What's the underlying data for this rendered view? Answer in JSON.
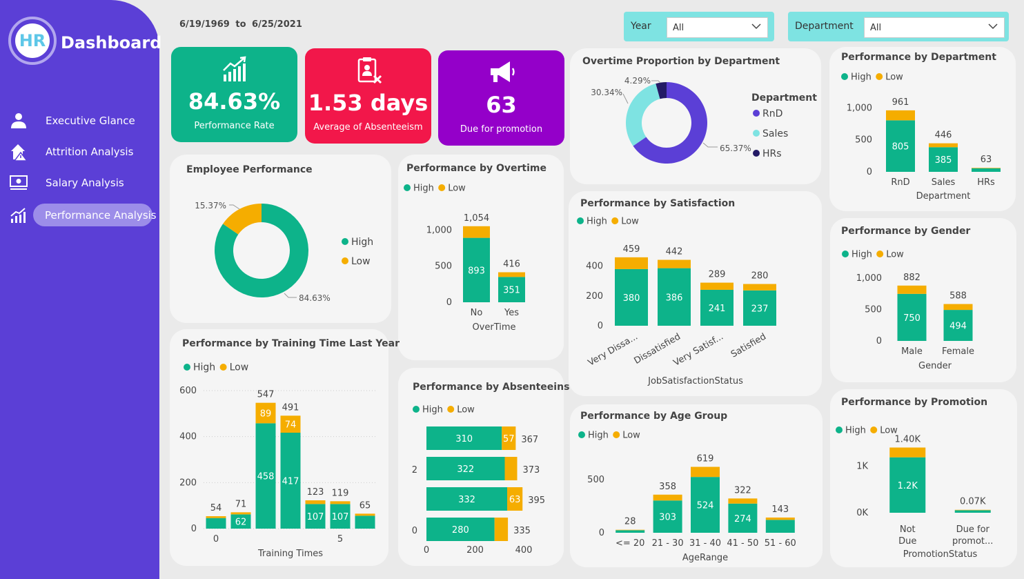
{
  "sidebar": {
    "logo_text": "HR",
    "brand": "Dashboard",
    "items": [
      {
        "label": "Executive Glance",
        "icon": "person-icon",
        "active": false
      },
      {
        "label": "Attrition Analysis",
        "icon": "house-warning-icon",
        "active": false
      },
      {
        "label": "Salary Analysis",
        "icon": "money-icon",
        "active": false
      },
      {
        "label": "Performance Analysis",
        "icon": "chart-up-icon",
        "active": true
      }
    ]
  },
  "header": {
    "date_from": "6/19/1969",
    "date_sep": "to",
    "date_to": "6/25/2021",
    "year_slicer": {
      "label": "Year",
      "value": "All"
    },
    "department_slicer": {
      "label": "Department",
      "value": "All"
    }
  },
  "kpis": [
    {
      "value": "84.63%",
      "label": "Performance Rate",
      "color": "#0db38a",
      "icon": "trend-up-icon"
    },
    {
      "value": "1.53 days",
      "label": "Average of Absenteeism",
      "color": "#f2174a",
      "icon": "clipboard-x-icon"
    },
    {
      "value": "63",
      "label": "Due for promotion",
      "color": "#9400c9",
      "icon": "megaphone-icon"
    }
  ],
  "colors": {
    "high": "#0db38a",
    "low": "#f5ad00",
    "rnd": "#5b3fd6",
    "sales": "#7ee3e2",
    "hrs": "#241b66"
  },
  "legend": {
    "high": "High",
    "low": "Low"
  },
  "chart_data": [
    {
      "id": "employee-performance",
      "type": "pie",
      "title": "Employee Performance",
      "slices": [
        {
          "name": "High",
          "value": 84.63,
          "label": "84.63%"
        },
        {
          "name": "Low",
          "value": 15.37,
          "label": "15.37%"
        }
      ]
    },
    {
      "id": "performance-by-overtime",
      "type": "bar",
      "title": "Performance by Overtime",
      "xlabel": "OverTime",
      "categories": [
        "No",
        "Yes"
      ],
      "series": [
        {
          "name": "High",
          "values": [
            893,
            351
          ]
        },
        {
          "name": "Low",
          "values": [
            161,
            65
          ]
        }
      ],
      "totals": [
        1054,
        416
      ],
      "ylim": [
        0,
        1100
      ],
      "yticks": [
        "0",
        "500",
        "1,000"
      ]
    },
    {
      "id": "overtime-proportion",
      "type": "pie",
      "title": "Overtime Proportion by Department",
      "legend_title": "Department",
      "slices": [
        {
          "name": "RnD",
          "value": 65.37,
          "label": "65.37%"
        },
        {
          "name": "Sales",
          "value": 30.34,
          "label": "30.34%"
        },
        {
          "name": "HRs",
          "value": 4.29,
          "label": "4.29%"
        }
      ]
    },
    {
      "id": "performance-by-department",
      "type": "bar",
      "title": "Performance by Department",
      "xlabel": "Department",
      "categories": [
        "RnD",
        "Sales",
        "HRs"
      ],
      "series": [
        {
          "name": "High",
          "values": [
            805,
            385,
            56
          ]
        },
        {
          "name": "Low",
          "values": [
            156,
            61,
            7
          ]
        }
      ],
      "totals": [
        961,
        446,
        63
      ],
      "ylim": [
        0,
        1100
      ],
      "yticks": [
        "0",
        "500",
        "1,000"
      ]
    },
    {
      "id": "performance-by-satisfaction",
      "type": "bar",
      "title": "Performance by Satisfaction",
      "xlabel": "JobSatisfactionStatus",
      "categories": [
        "Very Dissa...",
        "Dissatisfied",
        "Very Satisf...",
        "Satisfied"
      ],
      "series": [
        {
          "name": "High",
          "values": [
            380,
            386,
            241,
            237
          ]
        },
        {
          "name": "Low",
          "values": [
            79,
            56,
            48,
            43
          ]
        }
      ],
      "totals": [
        459,
        442,
        289,
        280
      ],
      "ylim": [
        0,
        500
      ],
      "yticks": [
        "0",
        "200",
        "400"
      ]
    },
    {
      "id": "performance-by-gender",
      "type": "bar",
      "title": "Performance by Gender",
      "xlabel": "Gender",
      "categories": [
        "Male",
        "Female"
      ],
      "series": [
        {
          "name": "High",
          "values": [
            750,
            494
          ]
        },
        {
          "name": "Low",
          "values": [
            132,
            94
          ]
        }
      ],
      "totals": [
        882,
        588
      ],
      "ylim": [
        0,
        1100
      ],
      "yticks": [
        "0",
        "500",
        "1,000"
      ]
    },
    {
      "id": "performance-by-training",
      "type": "bar",
      "title": "Performance by Training Time Last Year",
      "xlabel": "Training Times",
      "categories": [
        "0",
        "1",
        "2",
        "3",
        "4",
        "5",
        "6"
      ],
      "xtick_labels": [
        "0",
        "",
        "",
        "",
        "",
        "5",
        ""
      ],
      "series": [
        {
          "name": "High",
          "values": [
            46,
            62,
            458,
            417,
            107,
            107,
            56
          ]
        },
        {
          "name": "Low",
          "values": [
            8,
            9,
            89,
            74,
            16,
            12,
            9
          ]
        }
      ],
      "totals": [
        54,
        71,
        547,
        491,
        123,
        119,
        65
      ],
      "ylim": [
        0,
        600
      ],
      "yticks": [
        "0",
        "200",
        "400",
        "600"
      ]
    },
    {
      "id": "performance-by-absenteeism",
      "type": "bar",
      "orientation": "horizontal",
      "title": "Performance by Absenteeins",
      "categories": [
        "0",
        "1",
        "2",
        "3"
      ],
      "ytick_labels": [
        "",
        "2",
        "",
        "0"
      ],
      "series": [
        {
          "name": "High",
          "values": [
            310,
            322,
            332,
            280
          ]
        },
        {
          "name": "Low",
          "values": [
            57,
            51,
            63,
            55
          ]
        }
      ],
      "totals": [
        367,
        373,
        395,
        335
      ],
      "xlim": [
        0,
        400
      ],
      "xticks": [
        "0",
        "200",
        "400"
      ]
    },
    {
      "id": "performance-by-age",
      "type": "bar",
      "title": "Performance by Age Group",
      "xlabel": "AgeRange",
      "categories": [
        "<= 20",
        "21 - 30",
        "31 - 40",
        "41 - 50",
        "51 - 60"
      ],
      "series": [
        {
          "name": "High",
          "values": [
            24,
            303,
            524,
            274,
            121
          ]
        },
        {
          "name": "Low",
          "values": [
            4,
            55,
            95,
            48,
            22
          ]
        }
      ],
      "totals": [
        28,
        358,
        619,
        322,
        143
      ],
      "ylim": [
        0,
        700
      ],
      "yticks": [
        "0",
        "500"
      ]
    },
    {
      "id": "performance-by-promotion",
      "type": "bar",
      "title": "Performance by Promotion",
      "xlabel": "PromotionStatus",
      "categories": [
        "Not Due",
        "Due for promot..."
      ],
      "series": [
        {
          "name": "High",
          "values": [
            1190,
            54
          ]
        },
        {
          "name": "Low",
          "values": [
            210,
            9
          ]
        }
      ],
      "totals": [
        "1.40K",
        "0.07K"
      ],
      "high_labels": [
        "1.2K",
        ""
      ],
      "total_values": [
        1400,
        70
      ],
      "ylim": [
        0,
        1600
      ],
      "yticks": [
        "0K",
        "1K"
      ]
    }
  ]
}
